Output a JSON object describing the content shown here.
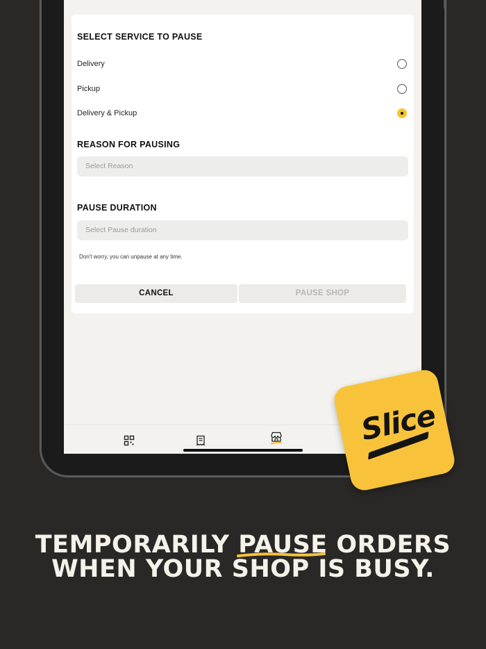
{
  "service_section": {
    "title": "SELECT SERVICE TO PAUSE",
    "options": [
      {
        "label": "Delivery",
        "selected": false
      },
      {
        "label": "Pickup",
        "selected": false
      },
      {
        "label": "Delivery & Pickup",
        "selected": true
      }
    ]
  },
  "reason_section": {
    "title": "REASON FOR PAUSING",
    "placeholder": "Select Reason"
  },
  "duration_section": {
    "title": "PAUSE DURATION",
    "placeholder": "Select Pause duration",
    "hint": "Don't worry, you can unpause at any time."
  },
  "actions": {
    "cancel_label": "CANCEL",
    "pause_label": "PAUSE SHOP"
  },
  "bottom_nav": {
    "items": [
      {
        "icon": "dashboard-icon",
        "active": false
      },
      {
        "icon": "receipt-icon",
        "active": false
      },
      {
        "icon": "storefront-icon",
        "active": true
      }
    ]
  },
  "brand": {
    "logo_text": "Slice",
    "accent_color": "#f8c33a"
  },
  "headline": {
    "line1": "TEMPORARILY PAUSE ORDERS",
    "line2": "WHEN YOUR SHOP IS BUSY."
  }
}
